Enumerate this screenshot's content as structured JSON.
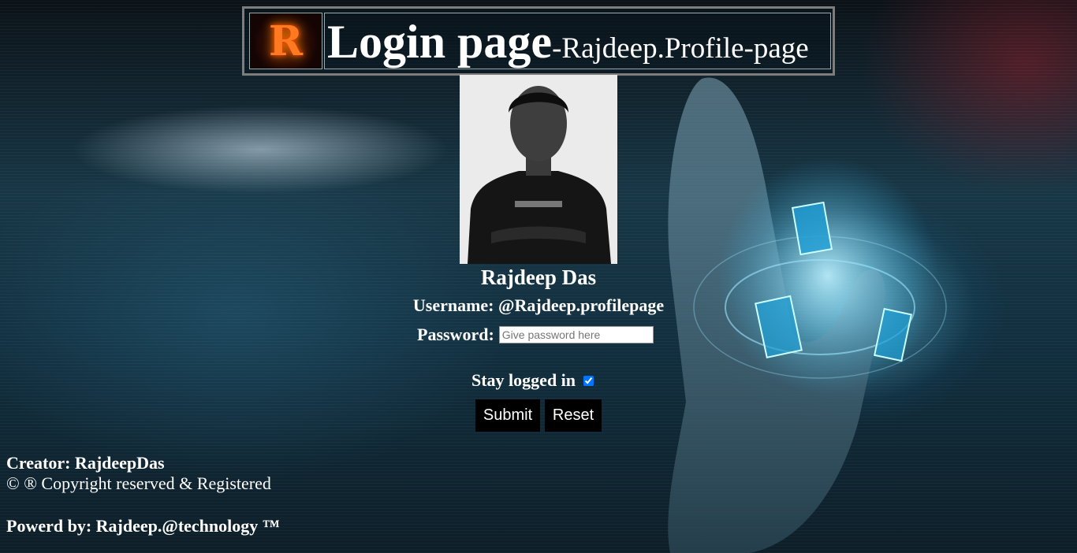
{
  "header": {
    "logo_text": "R",
    "title_main": "Login page",
    "title_sub": "-Rajdeep.Profile-page"
  },
  "profile": {
    "name": "Rajdeep Das",
    "username": "Username: @Rajdeep.profilepage"
  },
  "form": {
    "password_label": "Password:",
    "password_placeholder": "Give password here",
    "stay_logged_label": "Stay logged in",
    "stay_logged_checked": true,
    "submit_label": "Submit",
    "reset_label": "Reset"
  },
  "footer": {
    "creator": "Creator: RajdeepDas",
    "copyright": "© ® Copyright reserved & Registered",
    "powered": "Powerd by: Rajdeep.@technology ™"
  }
}
